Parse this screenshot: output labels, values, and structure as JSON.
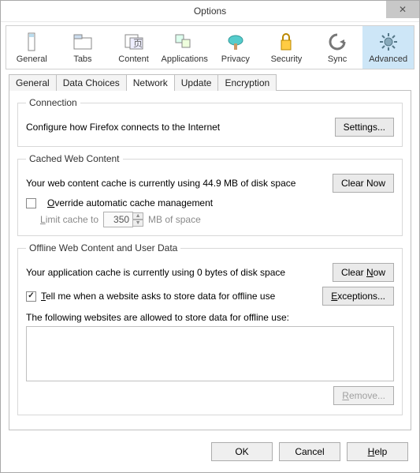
{
  "title": "Options",
  "topTabs": {
    "general": "General",
    "tabs": "Tabs",
    "content": "Content",
    "applications": "Applications",
    "privacy": "Privacy",
    "security": "Security",
    "sync": "Sync",
    "advanced": "Advanced"
  },
  "subTabs": {
    "general": "General",
    "dataChoices": "Data Choices",
    "network": "Network",
    "update": "Update",
    "encryption": "Encryption"
  },
  "connection": {
    "legend": "Connection",
    "desc": "Configure how Firefox connects to the Internet",
    "settingsBtn": "Settings..."
  },
  "cache": {
    "legend": "Cached Web Content",
    "usage": "Your web content cache is currently using 44.9 MB of disk space",
    "clearBtn": "Clear Now",
    "overrideLabel": "Override automatic cache management",
    "limitPrefix": "Limit cache to",
    "limitValue": "350",
    "limitSuffix": "MB of space"
  },
  "offline": {
    "legend": "Offline Web Content and User Data",
    "usage": "Your application cache is currently using 0 bytes of disk space",
    "clearBtn": "Clear Now",
    "tellMeLabel": "Tell me when a website asks to store data for offline use",
    "exceptionsBtn": "Exceptions...",
    "allowedText": "The following websites are allowed to store data for offline use:",
    "removeBtn": "Remove..."
  },
  "footer": {
    "ok": "OK",
    "cancel": "Cancel",
    "help": "Help"
  }
}
